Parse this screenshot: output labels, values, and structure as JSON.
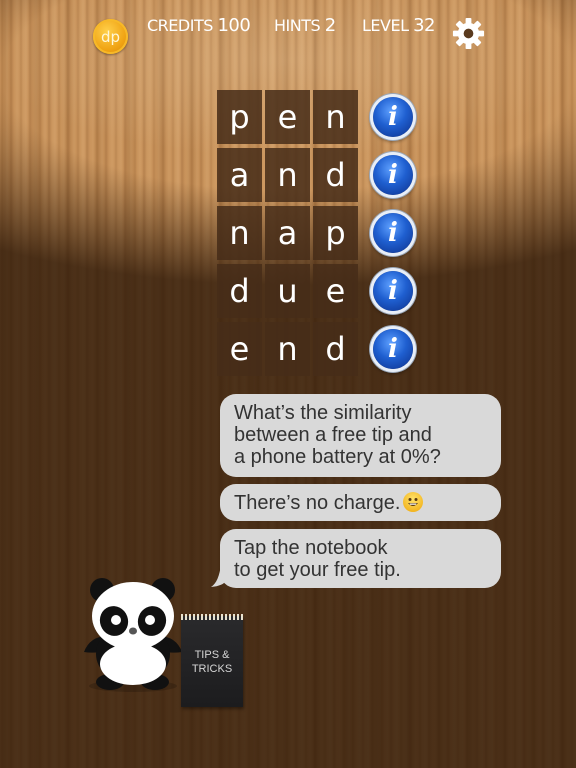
{
  "hud": {
    "coin_label": "dp",
    "credits_label": "CREDITS",
    "credits_value": "100",
    "hints_label": "HINTS",
    "hints_value": "2",
    "level_label": "LEVEL",
    "level_value": "32",
    "settings_icon": "gear-icon"
  },
  "puzzle": {
    "rows": [
      {
        "letters": [
          "p",
          "e",
          "n"
        ],
        "word": "pen"
      },
      {
        "letters": [
          "a",
          "n",
          "d"
        ],
        "word": "and"
      },
      {
        "letters": [
          "n",
          "a",
          "p"
        ],
        "word": "nap"
      },
      {
        "letters": [
          "d",
          "u",
          "e"
        ],
        "word": "due"
      },
      {
        "letters": [
          "e",
          "n",
          "d"
        ],
        "word": "end"
      }
    ],
    "info_icon_label": "i"
  },
  "chat": {
    "messages": [
      {
        "lines": [
          "What’s the similarity",
          "between a free tip and",
          "a phone battery at 0%?"
        ]
      },
      {
        "lines": [
          "There’s no charge."
        ],
        "emoji": "smiley"
      },
      {
        "lines": [
          "Tap the notebook",
          "to get  your free tip."
        ]
      }
    ]
  },
  "notebook": {
    "line1": "TIPS  &",
    "line2": "TRICKS"
  },
  "colors": {
    "wood": "#c8925a",
    "tile": "#46301c",
    "bubble": "#d9d9d9",
    "info_blue": "#1f5fd0",
    "coin": "#f0a313"
  }
}
